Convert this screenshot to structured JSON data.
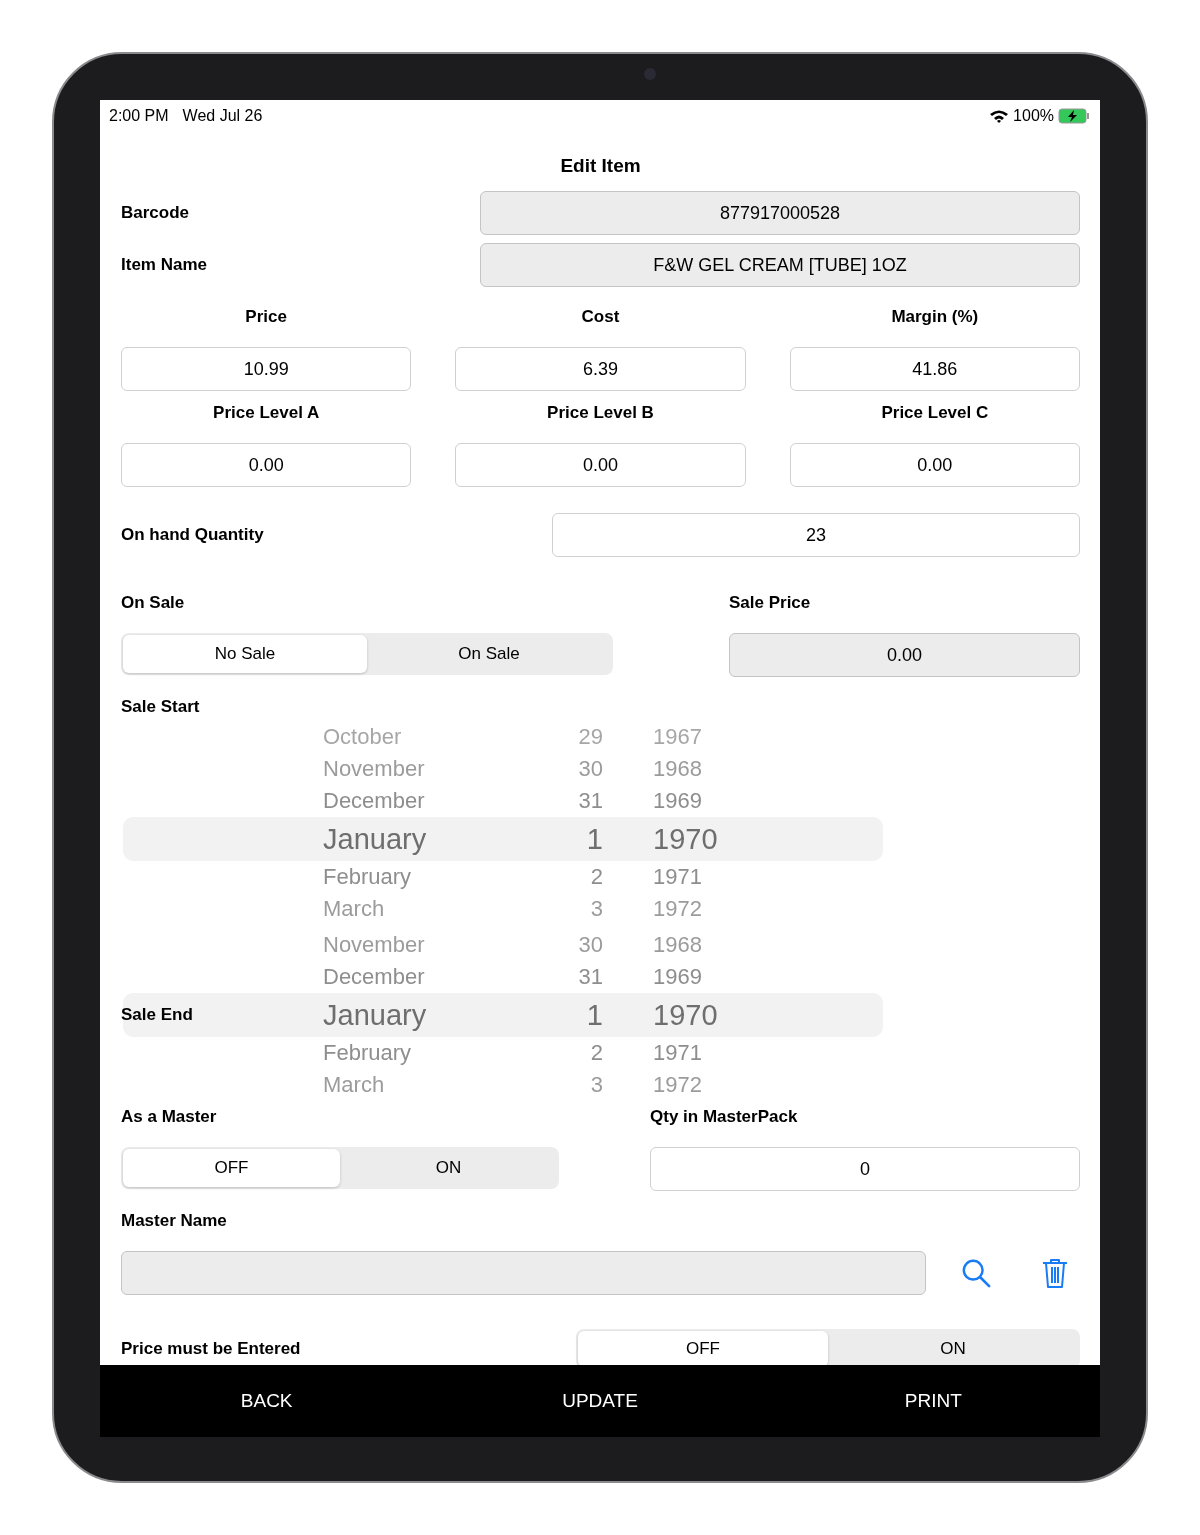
{
  "status_bar": {
    "time": "2:00 PM",
    "date": "Wed Jul 26",
    "battery": "100%"
  },
  "title": "Edit Item",
  "barcode": {
    "label": "Barcode",
    "value": "877917000528",
    "readonly": true
  },
  "item_name": {
    "label": "Item Name",
    "value": "F&W GEL CREAM [TUBE] 1OZ",
    "readonly": true
  },
  "prices": [
    {
      "label": "Price",
      "value": "10.99"
    },
    {
      "label": "Cost",
      "value": "6.39"
    },
    {
      "label": "Margin (%)",
      "value": "41.86"
    }
  ],
  "price_levels": [
    {
      "label": "Price Level A",
      "value": "0.00"
    },
    {
      "label": "Price Level B",
      "value": "0.00"
    },
    {
      "label": "Price Level C",
      "value": "0.00"
    }
  ],
  "on_hand": {
    "label": "On hand Quantity",
    "value": "23",
    "readonly": false
  },
  "on_sale": {
    "label": "On Sale",
    "segments": [
      {
        "label": "No Sale",
        "selected": true
      },
      {
        "label": "On Sale",
        "selected": false
      }
    ]
  },
  "sale_price": {
    "label": "Sale Price",
    "value": "0.00",
    "readonly": true
  },
  "sale_start": {
    "label": "Sale Start",
    "rows": [
      {
        "month": "October",
        "day": "29",
        "year": "1967",
        "selected": false
      },
      {
        "month": "November",
        "day": "30",
        "year": "1968",
        "selected": false
      },
      {
        "month": "December",
        "day": "31",
        "year": "1969",
        "selected": false
      },
      {
        "month": "January",
        "day": "1",
        "year": "1970",
        "selected": true
      },
      {
        "month": "February",
        "day": "2",
        "year": "1971",
        "selected": false
      },
      {
        "month": "March",
        "day": "3",
        "year": "1972",
        "selected": false
      }
    ]
  },
  "sale_end": {
    "label": "Sale End",
    "rows": [
      {
        "month": "November",
        "day": "30",
        "year": "1968",
        "selected": false
      },
      {
        "month": "December",
        "day": "31",
        "year": "1969",
        "selected": false
      },
      {
        "month": "January",
        "day": "1",
        "year": "1970",
        "selected": true
      },
      {
        "month": "February",
        "day": "2",
        "year": "1971",
        "selected": false
      },
      {
        "month": "March",
        "day": "3",
        "year": "1972",
        "selected": false
      }
    ]
  },
  "as_master": {
    "label": "As a Master",
    "segments": [
      {
        "label": "OFF",
        "selected": true
      },
      {
        "label": "ON",
        "selected": false
      }
    ]
  },
  "qty_master": {
    "label": "Qty in MasterPack",
    "value": "0",
    "readonly": false
  },
  "master_name": {
    "label": "Master Name",
    "readonly": true
  },
  "price_entered": {
    "label": "Price must be Entered",
    "segments": [
      {
        "label": "OFF",
        "selected": true
      },
      {
        "label": "ON",
        "selected": false
      }
    ]
  },
  "bottom_bar": [
    "BACK",
    "UPDATE",
    "PRINT"
  ]
}
